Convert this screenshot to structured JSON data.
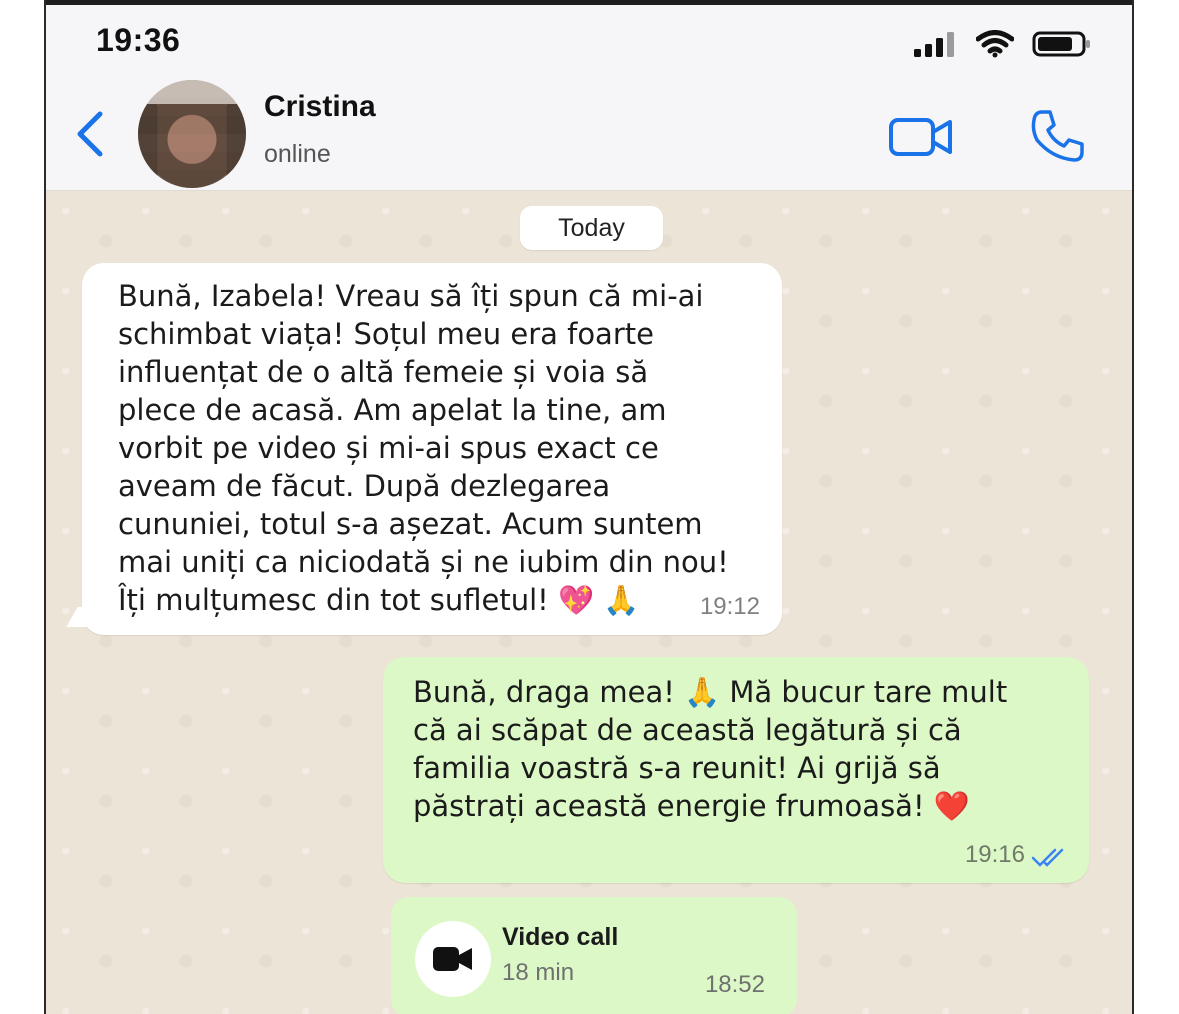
{
  "status_bar": {
    "time": "19:36"
  },
  "header": {
    "contact_name": "Cristina",
    "presence": "online"
  },
  "chat": {
    "date_separator": "Today",
    "messages": [
      {
        "direction": "incoming",
        "text": "Bună, Izabela! Vreau să îți spun că mi-ai\nschimbat viața! Soțul meu era foarte\ninfluențat de o altă femeie și voia să\nplece de acasă. Am apelat la tine, am\nvorbit pe video și mi-ai spus exact ce\naveam de făcut. După dezlegarea\ncununiei, totul s-a așezat. Acum suntem\nmai uniți ca niciodată și ne iubim din nou!\nÎți mulțumesc din tot sufletul! 💖 🙏",
        "time": "19:12"
      },
      {
        "direction": "outgoing",
        "text": "Bună, draga mea! 🙏 Mă bucur tare mult\ncă ai scăpat de această legătură și că\nfamilia voastră s-a reunit! Ai grijă să\npăstrați această energie frumoasă! ❤️",
        "time": "19:16",
        "read_status": "read"
      }
    ],
    "call_log": {
      "title": "Video call",
      "duration": "18 min",
      "time": "18:52"
    }
  },
  "colors": {
    "accent": "#1a73e8",
    "incoming_bubble": "#ffffff",
    "outgoing_bubble": "#dcf8c6",
    "chat_background": "#ece4d7"
  },
  "icons": {
    "back": "chevron-left-icon",
    "video": "video-camera-icon",
    "phone": "phone-icon",
    "signal": "signal-icon",
    "wifi": "wifi-icon",
    "battery": "battery-icon"
  }
}
